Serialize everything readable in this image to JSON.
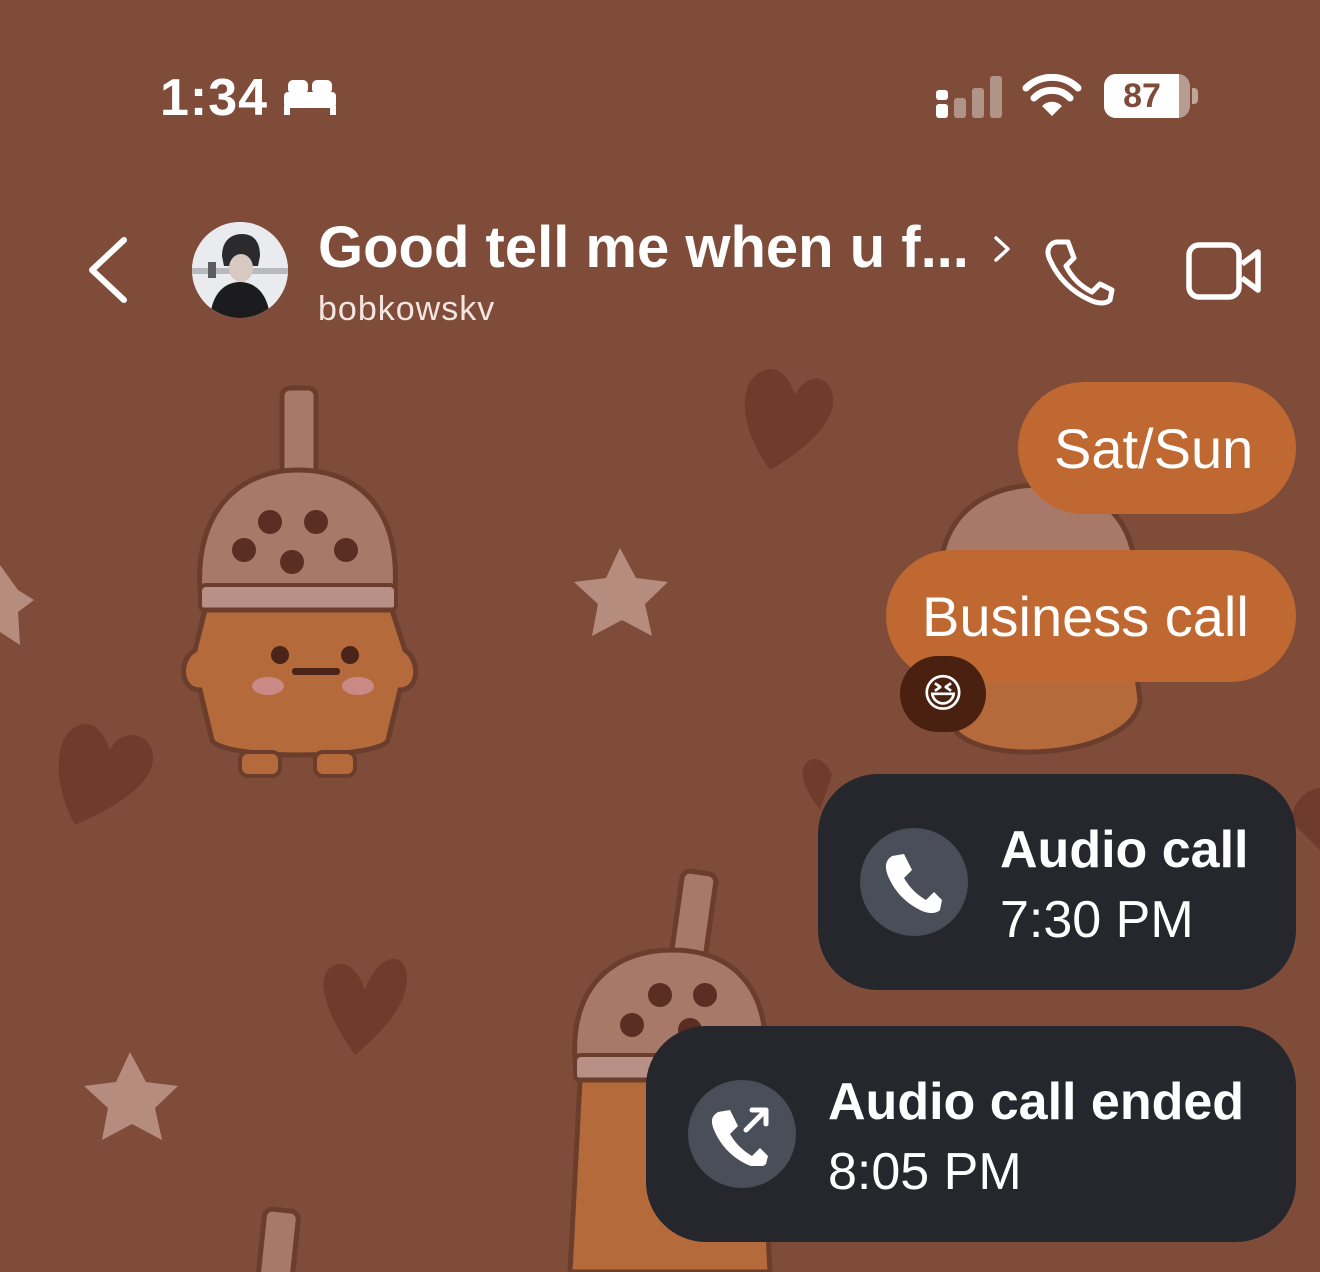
{
  "status_bar": {
    "time": "1:34",
    "focus_icon": "bed-icon",
    "battery_level": "87",
    "battery_fraction": 0.87
  },
  "header": {
    "title": "Good tell me when u f...",
    "username": "bobkowskv",
    "icons": [
      "chevron-left-icon",
      "chevron-right-icon",
      "phone-icon",
      "video-camera-icon"
    ]
  },
  "messages": [
    {
      "type": "text",
      "text": "Sat/Sun"
    },
    {
      "type": "text",
      "text": "Business call",
      "reaction": "😆"
    },
    {
      "type": "call",
      "title": "Audio call",
      "time": "7:30 PM",
      "icon": "phone-icon"
    },
    {
      "type": "call",
      "title": "Audio call ended",
      "time": "8:05 PM",
      "icon": "phone-outgoing-icon"
    }
  ],
  "colors": {
    "background": "#7f4c3a",
    "sent_bubble": "#c06831",
    "call_card": "#25272d",
    "call_icon_bg": "#4a4e58",
    "reaction_bg": "#4a2010"
  }
}
